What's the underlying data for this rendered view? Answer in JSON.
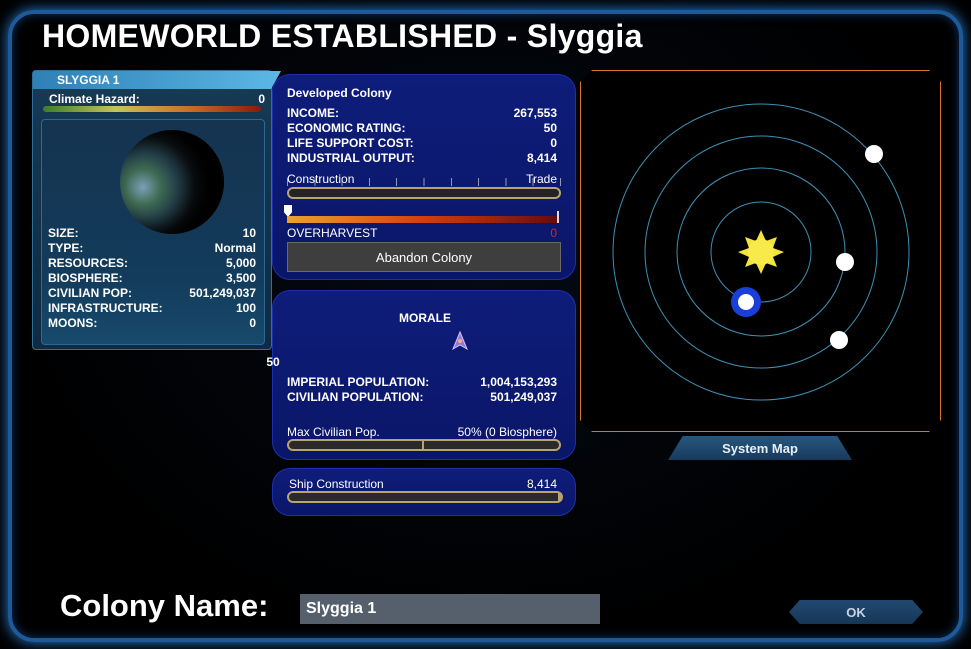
{
  "title": "HOMEWORLD ESTABLISHED - Slyggia",
  "planet": {
    "name": "SLYGGIA 1",
    "climate_hazard_label": "Climate Hazard:",
    "climate_hazard_value": "0",
    "stats": [
      {
        "label": "SIZE:",
        "value": "10"
      },
      {
        "label": "TYPE:",
        "value": "Normal"
      },
      {
        "label": "RESOURCES:",
        "value": "5,000"
      },
      {
        "label": "BIOSPHERE:",
        "value": "3,500"
      },
      {
        "label": "CIVILIAN POP:",
        "value": "501,249,037"
      },
      {
        "label": "INFRASTRUCTURE:",
        "value": "100"
      },
      {
        "label": "MOONS:",
        "value": "0"
      }
    ]
  },
  "colony": {
    "title": "Developed Colony",
    "rows": [
      {
        "label": "INCOME:",
        "value": "267,553"
      },
      {
        "label": "ECONOMIC RATING:",
        "value": "50"
      },
      {
        "label": "LIFE SUPPORT COST:",
        "value": "0"
      },
      {
        "label": "INDUSTRIAL OUTPUT:",
        "value": "8,414"
      }
    ],
    "slider_left": "Construction",
    "slider_right": "Trade",
    "overharvest_label": "OVERHARVEST",
    "overharvest_value": "0",
    "abandon_label": "Abandon Colony"
  },
  "morale": {
    "title": "MORALE",
    "value": "50",
    "rows": [
      {
        "label": "IMPERIAL POPULATION:",
        "value": "1,004,153,293"
      },
      {
        "label": "CIVILIAN POPULATION:",
        "value": "501,249,037"
      }
    ],
    "max_civ_label": "Max Civilian Pop.",
    "max_civ_value": "50% (0 Biosphere)",
    "max_civ_fraction": 0.5
  },
  "ship": {
    "label": "Ship Construction",
    "value": "8,414"
  },
  "system_map_label": "System Map",
  "colony_name_label": "Colony Name:",
  "colony_name_value": "Slyggia 1",
  "ok_label": "OK",
  "colors": {
    "panel_blue": "#0e1d7a",
    "map_border": "#d9742e",
    "orbit": "#3f8fb4",
    "star": "#f4e33a",
    "homeworld_ring": "#1a3fd8"
  },
  "icons": {
    "morale": "ship-emblem-icon",
    "star": "sun-icon"
  }
}
